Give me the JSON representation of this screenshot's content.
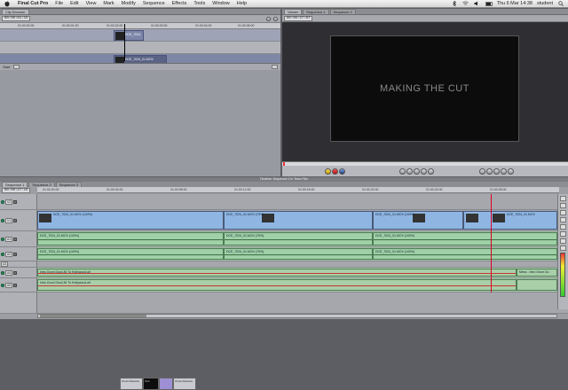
{
  "menubar": {
    "app": "Final Cut Pro",
    "items": [
      "File",
      "Edit",
      "View",
      "Mark",
      "Modify",
      "Sequence",
      "Effects",
      "Tools",
      "Window",
      "Help"
    ],
    "clock": "Thu 6 Mar  14:38",
    "user": "student"
  },
  "browser": {
    "tab": "Clip Browser",
    "timecode": "00:00:01:15",
    "ruler": [
      "01:00:00:00",
      "01:00:01:00",
      "01:00:02:00",
      "01:00:03:00",
      "01:00:04:00",
      "01:00:05:00"
    ],
    "clip_top_label": "DCE_7024",
    "clip_bottom_label": "DCE_7024_01.MOV",
    "foot_label": "Start"
  },
  "viewer": {
    "tabs": [
      "Viewer",
      "Sequence 1",
      "Sequence 2"
    ],
    "timecode": "00:00:27:07",
    "frame_title": "MAKING THE CUT"
  },
  "timeline": {
    "title": "Timeline: Sequence 2 in Team Film",
    "tabs": [
      "Sequence 1",
      "Sequence 2",
      "Sequence 3"
    ],
    "timecode": "00:00:27:15",
    "ruler": [
      "01:00:00:00",
      "01:00:04:00",
      "01:00:08:00",
      "01:00:12:00",
      "01:00:16:00",
      "01:00:20:00",
      "01:00:24:00",
      "01:00:28:00"
    ],
    "tracks": {
      "v2": "V2",
      "v1": "V1",
      "a1": "A1",
      "a2": "A2",
      "a3": "A3",
      "a4": "A4",
      "a5": "A5"
    },
    "gen_clips": [
      "Cross Dissolve",
      "Text",
      "Cross Dissolve"
    ],
    "video_clips": [
      "DCE_7024_01.MOV (100%)",
      "DCE_7024_01.MOV (75%)",
      "DCE_7024_01.MOV (100%)",
      "DCE_7024_01.MOV"
    ],
    "audio_clips": [
      "DCE_7024_01.MOV (100%)",
      "DCE_7024_01.MOV (75%)",
      "DCE_7024_01.MOV (100%)"
    ],
    "music_clip": "Intro Drum Dos4-NI To Hollywood.aif",
    "music_end": "Mess - Intro Drum Do"
  }
}
